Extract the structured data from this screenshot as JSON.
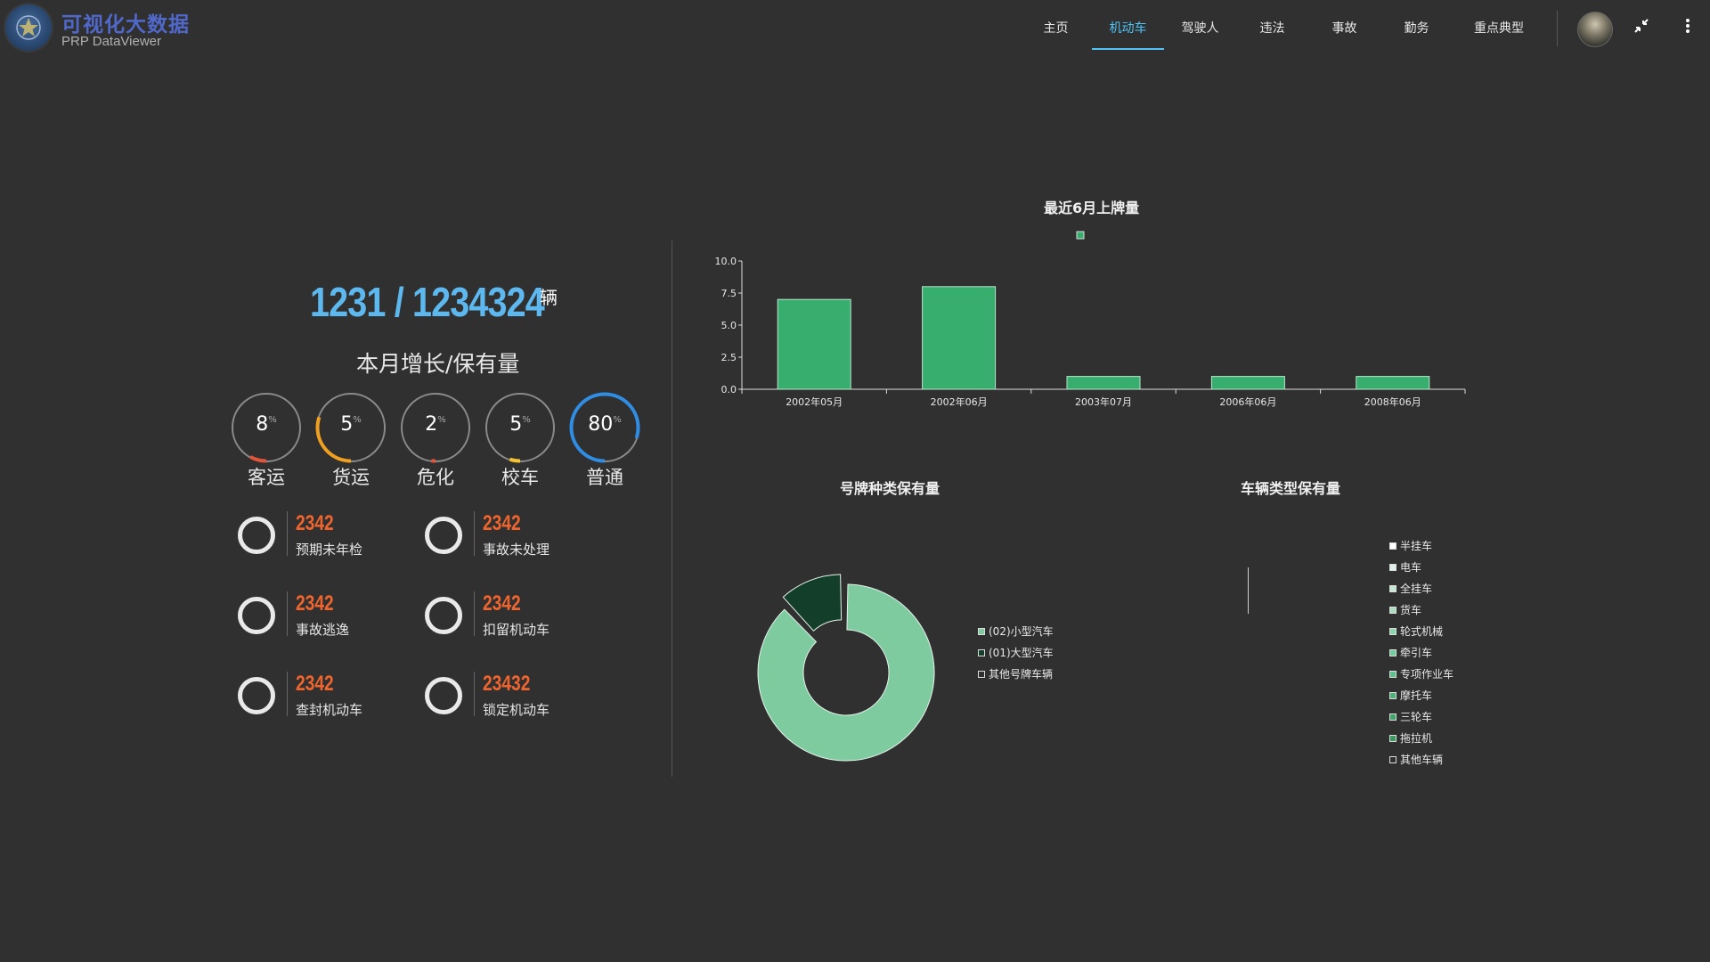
{
  "header": {
    "title": "可视化大数据",
    "subtitle": "PRP DataViewer",
    "nav": [
      {
        "label": "主页",
        "active": false
      },
      {
        "label": "机动车",
        "active": true
      },
      {
        "label": "驾驶人",
        "active": false
      },
      {
        "label": "违法",
        "active": false
      },
      {
        "label": "事故",
        "active": false
      },
      {
        "label": "勤务",
        "active": false
      },
      {
        "label": "重点典型",
        "active": false
      }
    ],
    "icons": [
      "avatar",
      "compress-icon",
      "more-vert-icon"
    ]
  },
  "summary": {
    "headline": "1231 / 1234324",
    "unit": "辆",
    "caption": "本月增长/保有量"
  },
  "gauges": [
    {
      "value": "8",
      "label": "客运",
      "fraction": 0.08,
      "color": "#e2553a"
    },
    {
      "value": "5",
      "label": "货运",
      "fraction": 0.3,
      "color": "#f0a020"
    },
    {
      "value": "2",
      "label": "危化",
      "fraction": 0.02,
      "color": "#e2553a"
    },
    {
      "value": "5",
      "label": "校车",
      "fraction": 0.05,
      "color": "#f2c230"
    },
    {
      "value": "80",
      "label": "普通",
      "fraction": 0.8,
      "color": "#2f8de4"
    }
  ],
  "gauge_unit": "%",
  "stats": [
    {
      "value": "2342",
      "label": "预期未年检"
    },
    {
      "value": "2342",
      "label": "事故未处理"
    },
    {
      "value": "2342",
      "label": "事故逃逸"
    },
    {
      "value": "2342",
      "label": "扣留机动车"
    },
    {
      "value": "2342",
      "label": "查封机动车"
    },
    {
      "value": "23432",
      "label": "锁定机动车"
    }
  ],
  "charts": {
    "bar_title": "最近6月上牌量",
    "donut_title": "号牌种类保有量",
    "vehicle_title": "车辆类型保有量"
  },
  "chart_data": [
    {
      "type": "bar",
      "title": "最近6月上牌量",
      "categories": [
        "2002年05月",
        "2002年06月",
        "2003年07月",
        "2006年06月",
        "2008年06月"
      ],
      "values": [
        7,
        8,
        1,
        1,
        1
      ],
      "ylim": [
        0,
        10
      ],
      "yticks": [
        "0.0",
        "2.5",
        "5.0",
        "7.5",
        "10.0"
      ],
      "color": "#37ae6e",
      "grid": false
    },
    {
      "type": "pie",
      "title": "号牌种类保有量",
      "categories": [
        "(02)小型汽车",
        "(01)大型汽车",
        "其他号牌车辆"
      ],
      "values": [
        88,
        12,
        0
      ],
      "colors": [
        "#7ecb9f",
        "#123e2a",
        "#ffffff"
      ],
      "legend": "right"
    },
    {
      "type": "pie",
      "title": "车辆类型保有量",
      "categories": [
        "半挂车",
        "电车",
        "全挂车",
        "货车",
        "轮式机械",
        "牵引车",
        "专项作业车",
        "摩托车",
        "三轮车",
        "拖拉机",
        "其他车辆"
      ],
      "values": [],
      "colors": [
        "#ffffff",
        "#dff2e6",
        "#c4e8d2",
        "#a9dfc0",
        "#8dd5ad",
        "#72cb9a",
        "#5fbf8a",
        "#4fb27b",
        "#42a46d",
        "#37975f",
        "#2b8a52"
      ],
      "legend": "right"
    }
  ]
}
